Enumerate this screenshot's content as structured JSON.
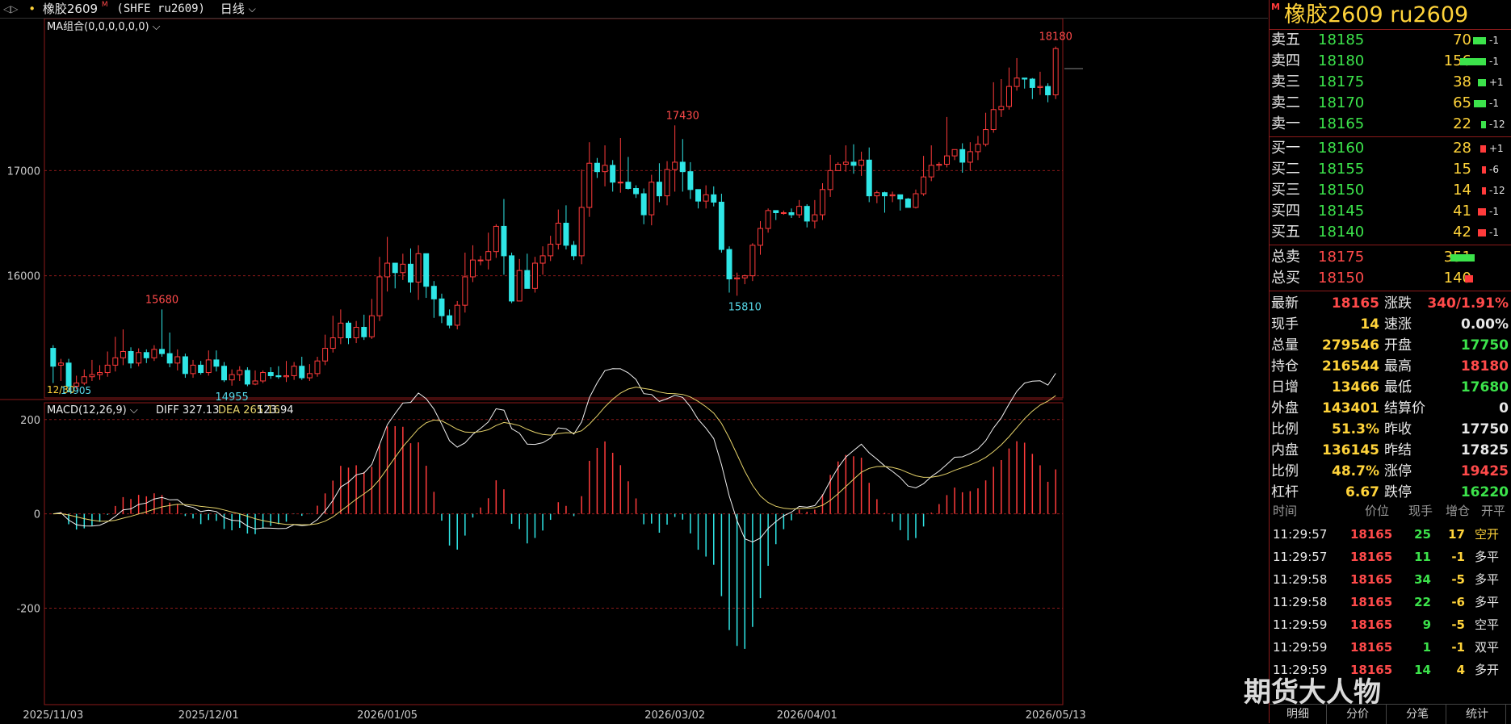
{
  "topbar": {
    "nav": "◁▷",
    "dot": "•",
    "symbol": "橡胶2609",
    "badge": "M",
    "exchange": "(SHFE ru2609)",
    "period": "日线",
    "chevron": "⌵"
  },
  "main_legend": "MA组合(0,0,0,0,0,0)",
  "macd_legend": {
    "name": "MACD(12,26,9)",
    "diff": "DIFF 327.13",
    "dea": "DEA 265.16",
    "macd": "123.94"
  },
  "y_labels": {
    "main": [
      "17000",
      "16000"
    ],
    "macd": [
      "200",
      "0",
      "-200"
    ]
  },
  "x_labels": [
    "2025/11/03",
    "2025/12/01",
    "2026/01/05",
    "2026/03/02",
    "2026/04/01",
    "2026/05/13"
  ],
  "annotations": {
    "high": "18180",
    "peak1": "17430",
    "p15680": "15680",
    "low1": "14955",
    "low_left": "14905",
    "low_left2": "12/30",
    "low2": "15810"
  },
  "colors": {
    "up": "#ff3b3b",
    "down": "#2fe6e6",
    "diff": "#f0f0f0",
    "dea": "#e6d36a",
    "grid": "#8b1a1a"
  },
  "chart_data": {
    "type": "candlestick",
    "ylim": [
      14900,
      18200
    ],
    "candles": [
      [
        15310,
        15140,
        15340,
        14980
      ],
      [
        15150,
        15170,
        15210,
        15000
      ],
      [
        15170,
        14950,
        15210,
        14900
      ],
      [
        14950,
        14980,
        15050,
        14920
      ],
      [
        14980,
        15040,
        15110,
        14960
      ],
      [
        15040,
        15060,
        15200,
        15000
      ],
      [
        15060,
        15080,
        15150,
        15010
      ],
      [
        15080,
        15150,
        15280,
        15040
      ],
      [
        15150,
        15220,
        15420,
        15090
      ],
      [
        15220,
        15280,
        15490,
        15150
      ],
      [
        15280,
        15170,
        15320,
        15120
      ],
      [
        15170,
        15270,
        15310,
        15140
      ],
      [
        15270,
        15220,
        15300,
        15170
      ],
      [
        15220,
        15300,
        15340,
        15190
      ],
      [
        15300,
        15260,
        15680,
        15230
      ],
      [
        15260,
        15170,
        15460,
        15130
      ],
      [
        15170,
        15230,
        15300,
        15100
      ],
      [
        15230,
        15070,
        15260,
        15030
      ],
      [
        15070,
        15150,
        15200,
        15030
      ],
      [
        15150,
        15080,
        15190,
        15060
      ],
      [
        15080,
        15200,
        15290,
        15050
      ],
      [
        15200,
        15140,
        15290,
        15090
      ],
      [
        15140,
        15010,
        15180,
        14990
      ],
      [
        15010,
        15060,
        15110,
        14955
      ],
      [
        15060,
        15100,
        15140,
        15000
      ],
      [
        15100,
        14970,
        15130,
        14950
      ],
      [
        14970,
        15000,
        15100,
        14960
      ],
      [
        15000,
        15080,
        15100,
        14980
      ],
      [
        15080,
        15050,
        15130,
        15020
      ],
      [
        15050,
        15040,
        15140,
        15020
      ],
      [
        15040,
        15050,
        15190,
        14990
      ],
      [
        15050,
        15140,
        15180,
        15010
      ],
      [
        15140,
        15030,
        15230,
        15010
      ],
      [
        15030,
        15070,
        15160,
        15000
      ],
      [
        15070,
        15190,
        15230,
        15040
      ],
      [
        15190,
        15310,
        15440,
        15150
      ],
      [
        15310,
        15410,
        15620,
        15270
      ],
      [
        15410,
        15550,
        15680,
        15350
      ],
      [
        15550,
        15410,
        15570,
        15350
      ],
      [
        15410,
        15510,
        15570,
        15360
      ],
      [
        15510,
        15420,
        15630,
        15390
      ],
      [
        15420,
        15620,
        15780,
        15400
      ],
      [
        15620,
        15990,
        16180,
        15570
      ],
      [
        15990,
        16120,
        16370,
        15850
      ],
      [
        16120,
        16030,
        16120,
        15880
      ],
      [
        16030,
        16110,
        16210,
        15960
      ],
      [
        16110,
        15940,
        16260,
        15840
      ],
      [
        15940,
        16210,
        16290,
        15770
      ],
      [
        16210,
        15900,
        16210,
        15790
      ],
      [
        15900,
        15780,
        15950,
        15600
      ],
      [
        15780,
        15620,
        15830,
        15550
      ],
      [
        15620,
        15530,
        15680,
        15500
      ],
      [
        15530,
        15720,
        15760,
        15490
      ],
      [
        15720,
        15990,
        16220,
        15650
      ],
      [
        15990,
        16150,
        16290,
        15940
      ],
      [
        16150,
        16150,
        16190,
        16100
      ],
      [
        16150,
        16230,
        16410,
        16060
      ],
      [
        16230,
        16470,
        16490,
        16170
      ],
      [
        16470,
        16190,
        16730,
        16010
      ],
      [
        16190,
        15760,
        16220,
        15740
      ],
      [
        15760,
        16050,
        16160,
        15990
      ],
      [
        16050,
        15880,
        16210,
        15880
      ],
      [
        15880,
        16120,
        16180,
        15840
      ],
      [
        16120,
        16190,
        16280,
        16010
      ],
      [
        16190,
        16300,
        16380,
        16140
      ],
      [
        16300,
        16500,
        16630,
        16250
      ],
      [
        16500,
        16290,
        16670,
        16250
      ],
      [
        16290,
        16190,
        16330,
        16150
      ],
      [
        16190,
        16650,
        17010,
        16110
      ],
      [
        16650,
        17070,
        17270,
        16560
      ],
      [
        17070,
        16990,
        17120,
        16930
      ],
      [
        16990,
        17050,
        17240,
        16850
      ],
      [
        17050,
        16890,
        17100,
        16800
      ],
      [
        16890,
        16890,
        17310,
        16790
      ],
      [
        16890,
        16830,
        17130,
        16820
      ],
      [
        16830,
        16780,
        16860,
        16740
      ],
      [
        16780,
        16580,
        16830,
        16490
      ],
      [
        16580,
        16890,
        16960,
        16480
      ],
      [
        16890,
        16760,
        17070,
        16700
      ],
      [
        16760,
        17010,
        17090,
        16670
      ],
      [
        17010,
        17080,
        17430,
        16800
      ],
      [
        17080,
        16990,
        17300,
        16800
      ],
      [
        16990,
        16820,
        17080,
        16730
      ],
      [
        16820,
        16710,
        16760,
        16640
      ],
      [
        16710,
        16770,
        16860,
        16640
      ],
      [
        16770,
        16700,
        16850,
        16660
      ],
      [
        16700,
        16250,
        16780,
        16220
      ],
      [
        16250,
        15970,
        16280,
        15840
      ],
      [
        15970,
        15980,
        16030,
        15810
      ],
      [
        15980,
        16000,
        16010,
        15920
      ],
      [
        16000,
        16290,
        16310,
        15950
      ],
      [
        16290,
        16450,
        16520,
        16200
      ],
      [
        16450,
        16620,
        16640,
        16410
      ],
      [
        16620,
        16600,
        16620,
        16530
      ],
      [
        16600,
        16600,
        16620,
        16580
      ],
      [
        16600,
        16580,
        16640,
        16550
      ],
      [
        16580,
        16660,
        16720,
        16550
      ],
      [
        16660,
        16520,
        16680,
        16460
      ],
      [
        16520,
        16580,
        16720,
        16450
      ],
      [
        16580,
        16820,
        16880,
        16530
      ],
      [
        16820,
        17000,
        17150,
        16750
      ],
      [
        17000,
        17060,
        17080,
        17000
      ],
      [
        17060,
        17080,
        17240,
        16990
      ],
      [
        17080,
        17050,
        17250,
        16970
      ],
      [
        17050,
        17100,
        17180,
        16950
      ],
      [
        17100,
        16760,
        17220,
        16700
      ],
      [
        16760,
        16790,
        16810,
        16690
      ],
      [
        16790,
        16760,
        16800,
        16600
      ],
      [
        16760,
        16770,
        16800,
        16700
      ],
      [
        16770,
        16730,
        16770,
        16620
      ],
      [
        16730,
        16650,
        16740,
        16650
      ],
      [
        16650,
        16780,
        16820,
        16640
      ],
      [
        16780,
        16940,
        17140,
        16760
      ],
      [
        16940,
        17050,
        17240,
        16900
      ],
      [
        17050,
        17060,
        17080,
        17000
      ],
      [
        17060,
        17140,
        17510,
        17030
      ],
      [
        17140,
        17200,
        17200,
        17100
      ],
      [
        17200,
        17080,
        17260,
        16980
      ],
      [
        17080,
        17180,
        17270,
        17000
      ],
      [
        17180,
        17250,
        17330,
        17100
      ],
      [
        17250,
        17390,
        17550,
        17230
      ],
      [
        17390,
        17580,
        17840,
        17360
      ],
      [
        17580,
        17610,
        17870,
        17510
      ],
      [
        17610,
        17800,
        17980,
        17580
      ],
      [
        17800,
        17880,
        18070,
        17760
      ],
      [
        17880,
        17870,
        17880,
        17780
      ],
      [
        17870,
        17790,
        17880,
        17680
      ],
      [
        17790,
        17800,
        17940,
        17720
      ],
      [
        17800,
        17720,
        17830,
        17650
      ],
      [
        17720,
        18160,
        18180,
        17680
      ]
    ]
  },
  "panel": {
    "title_badge": "M",
    "title": "橡胶2609  ru2609",
    "asks": [
      {
        "label": "卖五",
        "price": "18185",
        "vol": "70",
        "chg": "-1",
        "bar": 0.45
      },
      {
        "label": "卖四",
        "price": "18180",
        "vol": "156",
        "chg": "-1",
        "bar": 1.0
      },
      {
        "label": "卖三",
        "price": "18175",
        "vol": "38",
        "chg": "+1",
        "bar": 0.25
      },
      {
        "label": "卖二",
        "price": "18170",
        "vol": "65",
        "chg": "-1",
        "bar": 0.42
      },
      {
        "label": "卖一",
        "price": "18165",
        "vol": "22",
        "chg": "-12",
        "bar": 0.12
      }
    ],
    "bids": [
      {
        "label": "买一",
        "price": "18160",
        "vol": "28",
        "chg": "+1",
        "bar": 0.18
      },
      {
        "label": "买二",
        "price": "18155",
        "vol": "15",
        "chg": "-6",
        "bar": 0.1
      },
      {
        "label": "买三",
        "price": "18150",
        "vol": "14",
        "chg": "-12",
        "bar": 0.09
      },
      {
        "label": "买四",
        "price": "18145",
        "vol": "41",
        "chg": "-1",
        "bar": 0.26
      },
      {
        "label": "买五",
        "price": "18140",
        "vol": "42",
        "chg": "-1",
        "bar": 0.27
      }
    ],
    "totals": [
      {
        "label": "总卖",
        "price": "18175",
        "vol": "351",
        "bar": 1.0,
        "color": "green"
      },
      {
        "label": "总买",
        "price": "18150",
        "vol": "140",
        "bar": 0.4,
        "color": "red"
      }
    ],
    "stats_left": [
      {
        "k": "最新",
        "v": "18165",
        "c": "red"
      },
      {
        "k": "现手",
        "v": "14",
        "c": "yellow"
      },
      {
        "k": "总量",
        "v": "279546",
        "c": "yellow"
      },
      {
        "k": "持仓",
        "v": "216544",
        "c": "yellow"
      },
      {
        "k": "日增",
        "v": "13466",
        "c": "yellow"
      },
      {
        "k": "外盘",
        "v": "143401",
        "c": "yellow"
      },
      {
        "k": "比例",
        "v": "51.3%",
        "c": "yellow"
      },
      {
        "k": "内盘",
        "v": "136145",
        "c": "yellow"
      },
      {
        "k": "比例",
        "v": "48.7%",
        "c": "yellow"
      },
      {
        "k": "杠杆",
        "v": "6.67",
        "c": "yellow"
      }
    ],
    "stats_right": [
      {
        "k": "涨跌",
        "v": "340/1.91%",
        "c": "red"
      },
      {
        "k": "速涨",
        "v": "0.00%",
        "c": "white"
      },
      {
        "k": "开盘",
        "v": "17750",
        "c": "green"
      },
      {
        "k": "最高",
        "v": "18180",
        "c": "red"
      },
      {
        "k": "最低",
        "v": "17680",
        "c": "green"
      },
      {
        "k": "结算价",
        "v": "0",
        "c": "white"
      },
      {
        "k": "昨收",
        "v": "17750",
        "c": "white"
      },
      {
        "k": "昨结",
        "v": "17825",
        "c": "white"
      },
      {
        "k": "涨停",
        "v": "19425",
        "c": "red"
      },
      {
        "k": "跌停",
        "v": "16220",
        "c": "green"
      }
    ],
    "tick_header": {
      "time": "时间",
      "price": "价位",
      "vol": "现手",
      "oi": "增仓",
      "type": "开平"
    },
    "ticks": [
      {
        "time": "11:29:57",
        "price": "18165",
        "vol": "25",
        "oi": "17",
        "type": "空开",
        "tc": "yellow"
      },
      {
        "time": "11:29:57",
        "price": "18165",
        "vol": "11",
        "oi": "-1",
        "type": "多平",
        "tc": "white"
      },
      {
        "time": "11:29:58",
        "price": "18165",
        "vol": "34",
        "oi": "-5",
        "type": "多平",
        "tc": "white"
      },
      {
        "time": "11:29:58",
        "price": "18165",
        "vol": "22",
        "oi": "-6",
        "type": "多平",
        "tc": "white"
      },
      {
        "time": "11:29:59",
        "price": "18165",
        "vol": "9",
        "oi": "-5",
        "type": "空平",
        "tc": "white"
      },
      {
        "time": "11:29:59",
        "price": "18165",
        "vol": "1",
        "oi": "-1",
        "type": "双平",
        "tc": "white"
      },
      {
        "time": "11:29:59",
        "price": "18165",
        "vol": "14",
        "oi": "4",
        "type": "多开",
        "tc": "white"
      }
    ],
    "tabs": [
      "明细",
      "分价",
      "分笔",
      "统计"
    ],
    "watermark": "期货大人物"
  }
}
